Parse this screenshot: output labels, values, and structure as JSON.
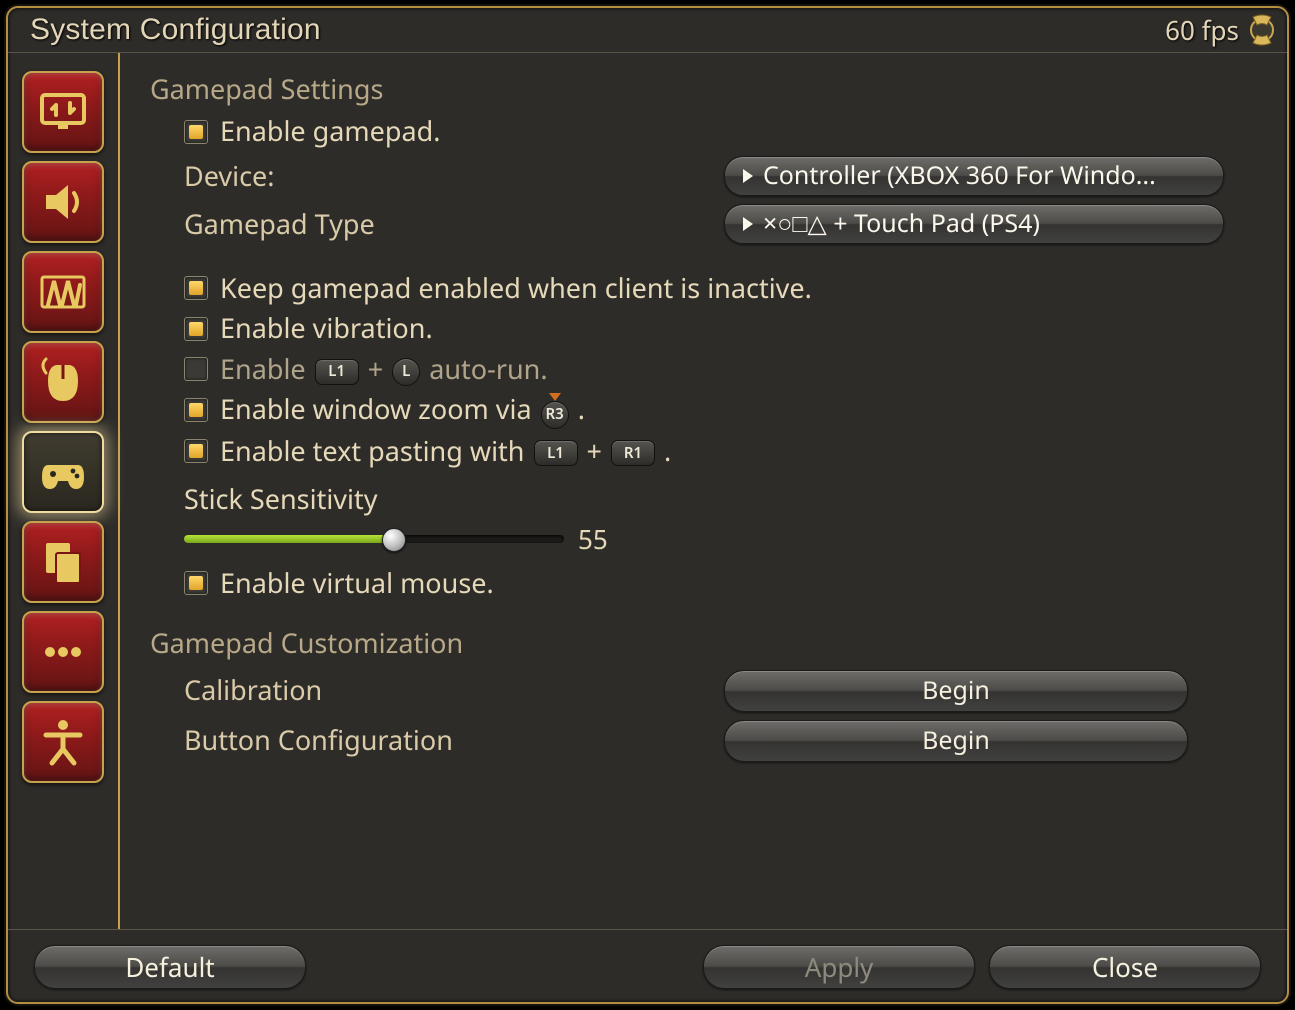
{
  "window": {
    "title": "System Configuration",
    "fps_label": "60 fps"
  },
  "sidebar": {
    "items": [
      {
        "id": "display",
        "selected": false
      },
      {
        "id": "sound",
        "selected": false
      },
      {
        "id": "graphics",
        "selected": false
      },
      {
        "id": "mouse",
        "selected": false
      },
      {
        "id": "gamepad",
        "selected": true
      },
      {
        "id": "other",
        "selected": false
      },
      {
        "id": "more",
        "selected": false
      },
      {
        "id": "accessibility",
        "selected": false
      }
    ]
  },
  "settings": {
    "section1_title": "Gamepad Settings",
    "enable_gamepad": {
      "checked": true,
      "label": "Enable gamepad."
    },
    "device": {
      "label": "Device:",
      "selected": "Controller (XBOX 360 For Windo..."
    },
    "gamepad_type": {
      "label": "Gamepad Type",
      "selected": "×○□△ + Touch Pad (PS4)"
    },
    "keep_enabled_inactive": {
      "checked": true,
      "label": "Keep gamepad enabled when client is inactive."
    },
    "enable_vibration": {
      "checked": true,
      "label": "Enable vibration."
    },
    "autorun": {
      "checked": false,
      "prefix": "Enable ",
      "chip1": "L1",
      "plus": "+",
      "chip2": "L",
      "suffix": "  auto-run."
    },
    "window_zoom": {
      "checked": true,
      "prefix": "Enable window zoom via ",
      "chip": "R3",
      "suffix": " ."
    },
    "text_pasting": {
      "checked": true,
      "prefix": "Enable text pasting with ",
      "chip1": "L1",
      "plus": " + ",
      "chip2": "R1",
      "suffix": "."
    },
    "stick_sensitivity": {
      "label": "Stick Sensitivity",
      "value": 55,
      "min": 0,
      "max": 100
    },
    "virtual_mouse": {
      "checked": true,
      "label": "Enable virtual mouse."
    },
    "section2_title": "Gamepad Customization",
    "calibration": {
      "label": "Calibration",
      "button": "Begin"
    },
    "button_config": {
      "label": "Button Configuration",
      "button": "Begin"
    }
  },
  "footer": {
    "default": "Default",
    "apply": "Apply",
    "close": "Close"
  }
}
